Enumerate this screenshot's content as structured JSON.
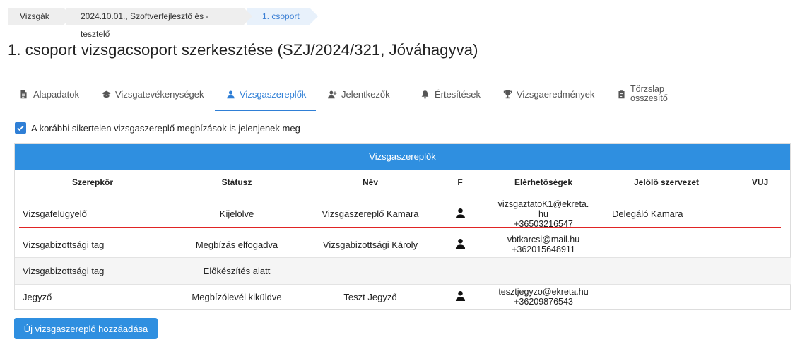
{
  "breadcrumb": {
    "items": [
      "Vizsgák",
      "2024.10.01., Szoftverfejlesztő és -tesztelő",
      "1. csoport"
    ]
  },
  "page_title": "1. csoport vizsgacsoport szerkesztése (SZJ/2024/321, Jóváhagyva)",
  "tabs": [
    {
      "label": "Alapadatok",
      "icon": "document-icon"
    },
    {
      "label": "Vizsgatevékenységek",
      "icon": "graduation-cap-icon"
    },
    {
      "label": "Vizsgaszereplők",
      "icon": "user-icon",
      "active": true
    },
    {
      "label": "Jelentkezők",
      "icon": "user-add-icon"
    },
    {
      "label": "Értesítések",
      "icon": "bell-icon"
    },
    {
      "label": "Vizsgaeredmények",
      "icon": "trophy-icon"
    },
    {
      "label_line1": "Törzslap",
      "label_line2": "összesítő",
      "icon": "clipboard-icon"
    }
  ],
  "show_failed_checkbox": {
    "checked": true,
    "label": "A korábbi sikertelen vizsgaszereplő megbízások is jelenjenek meg"
  },
  "table": {
    "caption": "Vizsgaszereplők",
    "headers": [
      "Szerepkör",
      "Státusz",
      "Név",
      "F",
      "Elérhetőségek",
      "Jelölő szervezet",
      "VUJ"
    ],
    "rows": [
      {
        "role": "Vizsgafelügyelő",
        "status": "Kijelölve",
        "name": "Vizsgaszereplő Kamara",
        "has_person_icon": true,
        "contact_line1": "vizsgaztatoK1@ekreta.",
        "contact_line2": "hu",
        "contact_line3": "+36503216547",
        "org": "Delegáló Kamara",
        "vuj": ""
      },
      {
        "role": "Vizsgabizottsági tag",
        "status": "Megbízás elfogadva",
        "name": "Vizsgabizottsági Károly",
        "has_person_icon": true,
        "contact_line1": "vbtkarcsi@mail.hu",
        "contact_line2": "+362015648911",
        "org": "",
        "vuj": ""
      },
      {
        "role": "Vizsgabizottsági tag",
        "status": "Előkészítés alatt",
        "name": "",
        "has_person_icon": false,
        "contact_line1": "",
        "contact_line2": "",
        "org": "",
        "vuj": ""
      },
      {
        "role": "Jegyző",
        "status": "Megbízólevél kiküldve",
        "name": "Teszt Jegyző",
        "has_person_icon": true,
        "contact_line1": "tesztjegyzo@ekreta.hu",
        "contact_line2": "+36209876543",
        "org": "",
        "vuj": ""
      }
    ]
  },
  "add_button_label": "Új vizsgaszereplő hozzáadása",
  "colors": {
    "primary": "#2f8fe0",
    "accent_tab": "#2f7fd6",
    "annotation_line": "#e02424"
  }
}
